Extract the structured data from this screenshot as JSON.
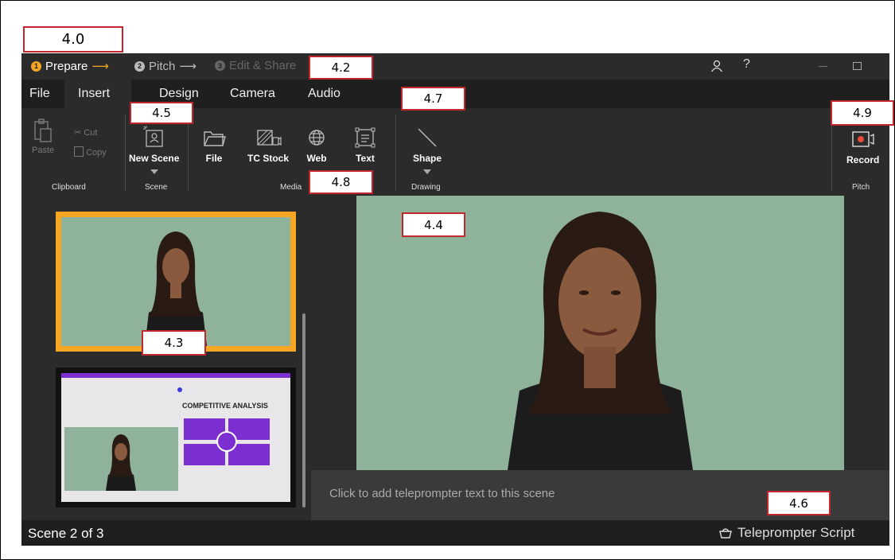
{
  "callouts": {
    "c40": "4.0",
    "c42": "4.2",
    "c45": "4.5",
    "c47": "4.7",
    "c49": "4.9",
    "c48": "4.8",
    "c44": "4.4",
    "c43": "4.3",
    "c46": "4.6"
  },
  "steps": [
    {
      "num": "1",
      "label": "Prepare",
      "arrow": "⟶"
    },
    {
      "num": "2",
      "label": "Pitch",
      "arrow": "⟶"
    },
    {
      "num": "3",
      "label": "Edit & Share"
    }
  ],
  "menu": [
    "File",
    "Insert",
    "Design",
    "Camera",
    "Audio"
  ],
  "ribbon": {
    "paste": "Paste",
    "cut": "Cut",
    "copy": "Copy",
    "clipboard_group": "Clipboard",
    "new_scene": "New Scene",
    "scene_group": "Scene",
    "file": "File",
    "tc_stock": "TC Stock",
    "web": "Web",
    "text": "Text",
    "media_group": "Media",
    "shape": "Shape",
    "drawing_group": "Drawing",
    "record": "Record",
    "pitch_group": "Pitch"
  },
  "slide2": {
    "title": "COMPETITIVE ANALYSIS"
  },
  "teleprompter": {
    "placeholder": "Click to add teleprompter text to this scene"
  },
  "status": {
    "scene": "Scene 2 of 3",
    "teleprompter_script": "Teleprompter Script"
  },
  "colors": {
    "accent": "#f5a623",
    "record": "#e74c3c",
    "purple": "#7b2fd1",
    "green": "#8fb39a"
  }
}
